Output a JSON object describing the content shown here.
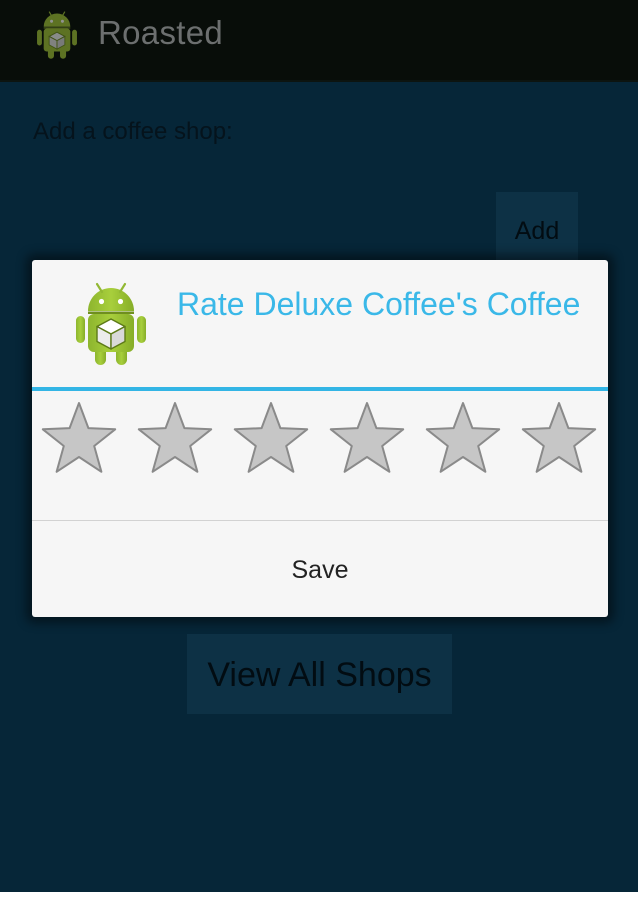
{
  "action_bar": {
    "title": "Roasted",
    "icon": "android-app-icon",
    "background": "#080d09"
  },
  "main": {
    "prompt_label": "Add a coffee shop:",
    "shop_name_input_value": "",
    "add_button_label": "Add",
    "view_all_button_label": "View All Shops",
    "background": "#062638"
  },
  "dialog": {
    "title": "Rate Deluxe Coffee's Coffee",
    "icon": "android-app-icon",
    "accent_color": "#33b5e5",
    "rating": {
      "num_stars": 6,
      "value": 0,
      "star_icon": "star-empty-icon"
    },
    "save_button_label": "Save"
  }
}
